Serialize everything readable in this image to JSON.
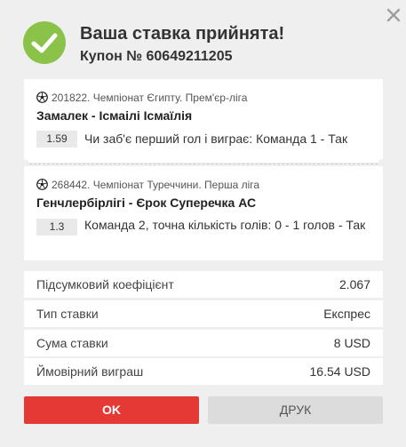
{
  "header": {
    "title": "Ваша ставка прийнята!",
    "coupon": "Купон № 60649211205"
  },
  "bets": [
    {
      "event": "201822. Чемпіонат Єгипту. Прем'єр-ліга",
      "teams": "Замалек - Ісмаілі Ісмаїлія",
      "odd": "1.59",
      "outcome": "Чи заб'є перший гол і виграє: Команда 1 - Так"
    },
    {
      "event": "268442. Чемпіонат Туреччини. Перша ліга",
      "teams": "Генчлербірлігі - Єрок Суперечка АС",
      "odd": "1.3",
      "outcome": "Команда 2, точна кількість голів: 0 - 1 голов - Так"
    }
  ],
  "summary": [
    {
      "label": "Підсумковий коефіцієнт",
      "value": "2.067"
    },
    {
      "label": "Тип ставки",
      "value": "Експрес"
    },
    {
      "label": "Сума ставки",
      "value": "8 USD"
    },
    {
      "label": "Ймовірний виграш",
      "value": "16.54 USD"
    }
  ],
  "buttons": {
    "ok": "OK",
    "print": "ДРУК"
  },
  "colors": {
    "success": "#8bc34a",
    "primary_button": "#e53935",
    "secondary_button": "#dcdcdc"
  },
  "icons": {
    "close": "close-icon",
    "success": "checkmark-icon",
    "sport": "soccer-ball-icon"
  }
}
